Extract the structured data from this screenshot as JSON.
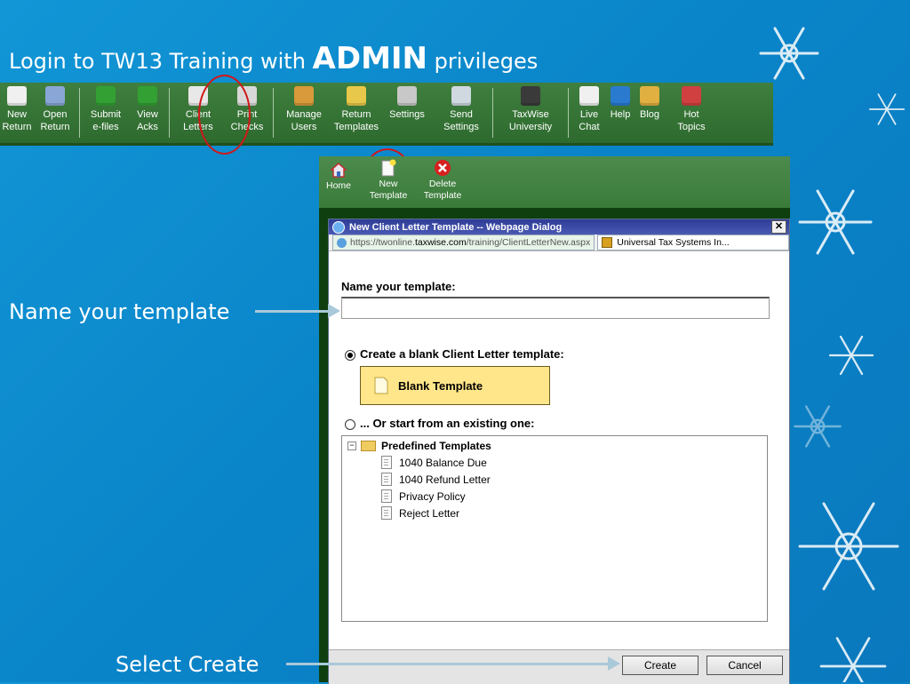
{
  "slide": {
    "title_prefix": "Login to TW13 Training with ",
    "title_bold": "ADMIN",
    "title_suffix": " privileges",
    "name_caption": "Name your template",
    "create_caption": "Select Create"
  },
  "toolbar": {
    "items": [
      {
        "label": "New\nReturn",
        "icon": "new-return-icon",
        "color": "#f0f0f0"
      },
      {
        "label": "Open\nReturn",
        "icon": "open-folder-icon",
        "color": "#8aa6d6"
      },
      {
        "label": "Submit\ne-files",
        "icon": "up-arrow-icon",
        "color": "#33a033"
      },
      {
        "label": "View\nAcks",
        "icon": "down-arrow-icon",
        "color": "#33a033"
      },
      {
        "label": "Client\nLetters",
        "icon": "envelope-icon",
        "color": "#e8e8e8"
      },
      {
        "label": "Print\nChecks",
        "icon": "printer-icon",
        "color": "#d8d8d8"
      },
      {
        "label": "Manage\nUsers",
        "icon": "users-icon",
        "color": "#d89a3a"
      },
      {
        "label": "Return\nTemplates",
        "icon": "templates-icon",
        "color": "#e8c84a"
      },
      {
        "label": "Settings",
        "icon": "tools-icon",
        "color": "#c8c8c8"
      },
      {
        "label": "Send\nSettings",
        "icon": "send-settings-icon",
        "color": "#d0d8e0"
      },
      {
        "label": "TaxWise\nUniversity",
        "icon": "graduate-icon",
        "color": "#3a3a3a"
      },
      {
        "label": "Live\nChat",
        "icon": "chat-icon",
        "color": "#f0f0f0"
      },
      {
        "label": "Help",
        "icon": "help-icon",
        "color": "#2a7ad0"
      },
      {
        "label": "Blog",
        "icon": "blog-icon",
        "color": "#e0b040"
      },
      {
        "label": "Hot\nTopics",
        "icon": "hot-topics-icon",
        "color": "#d04040"
      }
    ]
  },
  "subtoolbar": {
    "home": "Home",
    "new_template": "New\nTemplate",
    "delete_template": "Delete\nTemplate"
  },
  "dialog": {
    "title": "New Client Letter Template -- Webpage Dialog",
    "close": "✕",
    "url_prefix": "https://twonline.",
    "url_host": "taxwise.com",
    "url_path": "/training/ClientLetterNew.aspx",
    "security": "Universal Tax Systems In...",
    "name_label": "Name your template:",
    "name_value": "",
    "blank_option": "Create a blank Client Letter template:",
    "blank_button": "Blank Template",
    "existing_option": "... Or start from an existing one:",
    "tree": {
      "folder": "Predefined Templates",
      "items": [
        "1040 Balance Due",
        "1040 Refund Letter",
        "Privacy Policy",
        "Reject Letter"
      ]
    },
    "create": "Create",
    "cancel": "Cancel"
  },
  "colors": {
    "background": "#0a85c9",
    "toolbar_green": "#3a7b3a",
    "highlight_ring": "#d01818",
    "dialog_title": "#2e3c96",
    "blank_button": "#ffe68a"
  }
}
